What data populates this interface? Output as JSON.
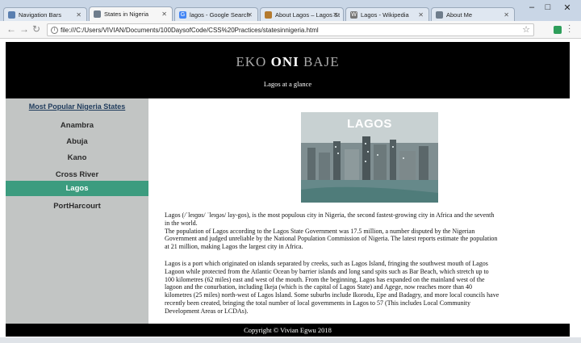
{
  "browser": {
    "tabs": [
      {
        "title": "Navigation Bars",
        "active": false,
        "favicon_color": "#5a7fb0"
      },
      {
        "title": "States in Nigeria",
        "active": true,
        "favicon_color": "#6f7d8c"
      },
      {
        "title": "lagos - Google Search",
        "active": false,
        "favicon_color": "#4285f4"
      },
      {
        "title": "About Lagos – Lagos St",
        "active": false,
        "favicon_color": "#b47a2e"
      },
      {
        "title": "Lagos - Wikipedia",
        "active": false,
        "favicon_color": "#777777"
      },
      {
        "title": "About Me",
        "active": false,
        "favicon_color": "#6f7d8c"
      }
    ],
    "url": "file:///C:/Users/VIVIAN/Documents/100DaysofCode/CSS%20Practices/statesinnigeria.html"
  },
  "header": {
    "title_words": [
      "EKO",
      "ONI",
      "BAJE"
    ],
    "tagline": "Lagos at a glance"
  },
  "sidebar": {
    "heading": "Most Popular Nigeria States",
    "items": [
      {
        "label": "Anambra",
        "active": false
      },
      {
        "label": "Abuja",
        "active": false
      },
      {
        "label": "Kano",
        "active": false
      },
      {
        "label": "Cross River",
        "active": false
      },
      {
        "label": "Lagos",
        "active": true
      },
      {
        "label": "PortHarcourt",
        "active": false
      }
    ]
  },
  "content": {
    "image_caption": "LAGOS",
    "paragraph1": "Lagos (/ˈleɪɡɒs/ ˈleɪɡəs/ lay-gos), is the most populous city in Nigeria, the second fastest-growing city in Africa and the seventh in the world.",
    "paragraph2": "The population of Lagos according to the Lagos State Government was 17.5 million, a number disputed by the Nigerian Government and judged unreliable by the National Population Commission of Nigeria. The latest reports estimate the population at 21 million, making Lagos the largest city in Africa.",
    "paragraph3": "Lagos is a port which originated on islands separated by creeks, such as Lagos Island, fringing the southwest mouth of Lagos Lagoon while protected from the Atlantic Ocean by barrier islands and long sand spits such as Bar Beach, which stretch up to 100 kilometres (62 miles) east and west of the mouth. From the beginning, Lagos has expanded on the mainland west of the lagoon and the conurbation, including Ikeja (which is the capital of Lagos State) and Agege, now reaches more than 40 kilometres (25 miles) north-west of Lagos Island. Some suburbs include Ikorodu, Epe and Badagry, and more local councils have recently been created, bringing the total number of local governments in Lagos to 57 (This includes Local Community Development Areas or LCDAs)."
  },
  "footer": {
    "text": "Copyright © Vivian Egwu 2018"
  },
  "colors": {
    "header_bg": "#000000",
    "sidebar_bg": "#c2c5c4",
    "active_item_bg": "#3c9c7f",
    "footer_bg": "#000000"
  }
}
